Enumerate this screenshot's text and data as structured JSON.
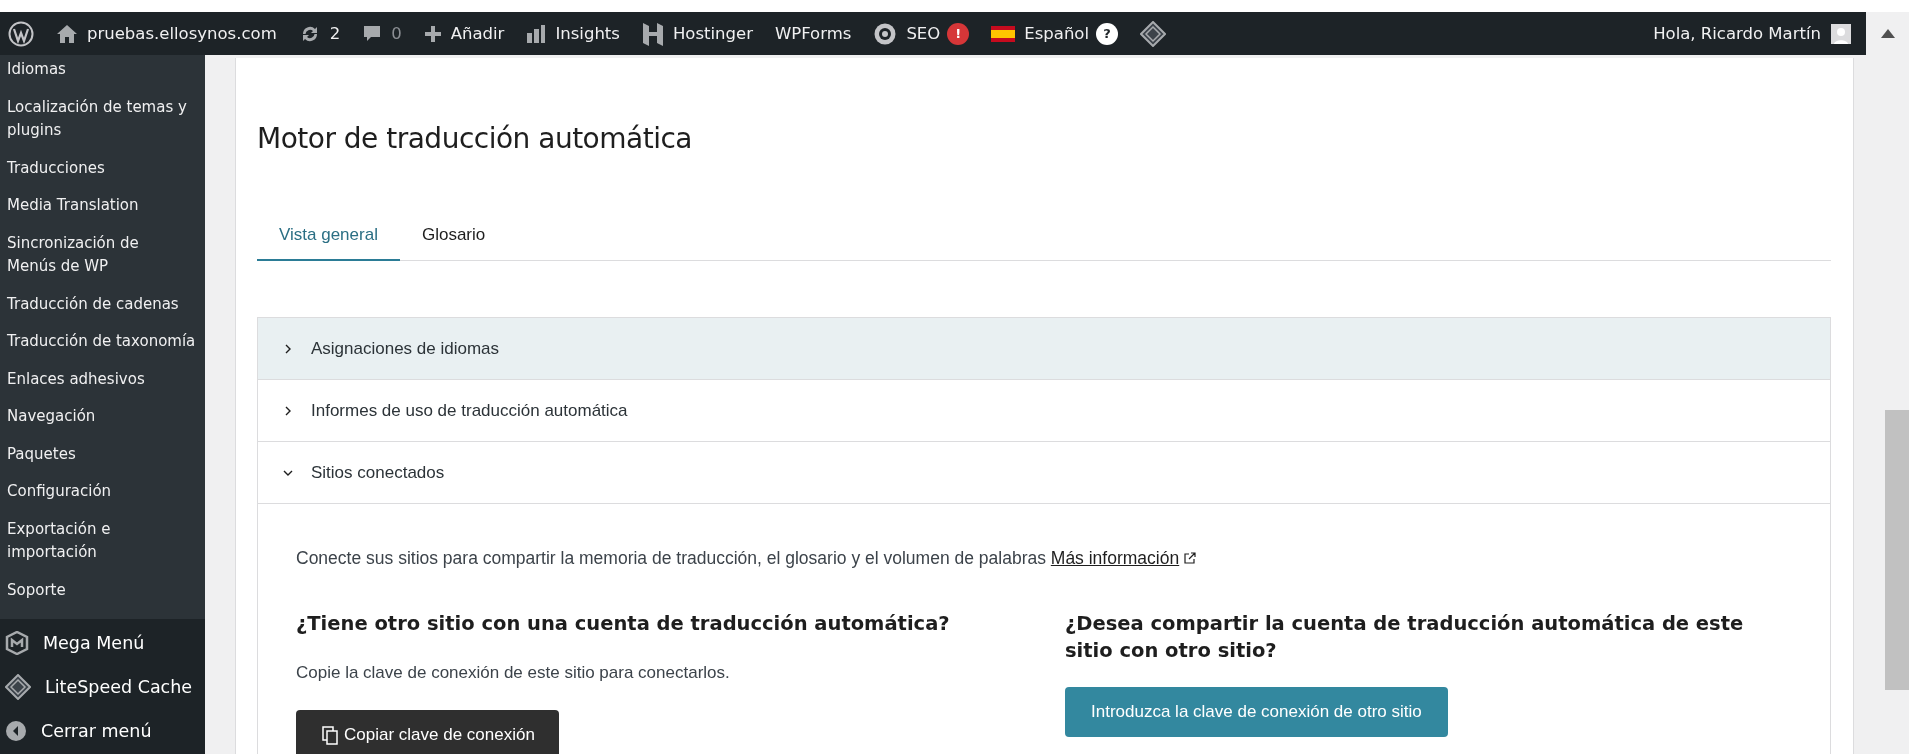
{
  "admin_bar": {
    "items": [
      {
        "kind": "wp-logo"
      },
      {
        "kind": "home",
        "label": "pruebas.ellosynos.com"
      },
      {
        "kind": "updates",
        "label": "2"
      },
      {
        "kind": "comments",
        "label": "0"
      },
      {
        "kind": "add",
        "label": "Añadir"
      },
      {
        "kind": "insights",
        "label": "Insights"
      },
      {
        "kind": "hostinger",
        "label": "Hostinger"
      },
      {
        "kind": "text",
        "label": "WPForms"
      },
      {
        "kind": "seo",
        "label": "SEO",
        "badge": "!"
      },
      {
        "kind": "language",
        "label": "Español",
        "badge": "?"
      },
      {
        "kind": "litespeed"
      }
    ],
    "greeting": "Hola, Ricardo Martín"
  },
  "sidebar": {
    "items": [
      "Idiomas",
      "Localización de temas y plugins",
      "Traducciones",
      "Media Translation",
      "Sincronización de Menús de WP",
      "Traducción de cadenas",
      "Traducción de taxonomía",
      "Enlaces adhesivos",
      "Navegación",
      "Paquetes",
      "Configuración",
      "Exportación e importación",
      "Soporte"
    ],
    "plugins": [
      {
        "kind": "megamenu",
        "label": "Mega Menú"
      },
      {
        "kind": "litespeed",
        "label": "LiteSpeed Cache"
      },
      {
        "kind": "collapse",
        "label": "Cerrar menú"
      }
    ]
  },
  "main": {
    "title": "Motor de traducción automática",
    "tabs": [
      {
        "label": "Vista general",
        "selected": true
      },
      {
        "label": "Glosario",
        "selected": false
      }
    ],
    "sections": [
      {
        "label": "Asignaciones de idiomas",
        "expanded": false,
        "highlighted": true
      },
      {
        "label": "Informes de uso de traducción automática",
        "expanded": false,
        "highlighted": false
      },
      {
        "label": "Sitios conectados",
        "expanded": true,
        "highlighted": false
      }
    ],
    "intro": "Conecte sus sitios para compartir la memoria de traducción, el glosario y el volumen de palabras",
    "intro_link": "Más información",
    "columns": [
      {
        "heading": "¿Tiene otro sitio con una cuenta de traducción automática?",
        "text": "Copie la clave de conexión de este sitio para conectarlos.",
        "button": {
          "kind": "copy",
          "label": "Copiar clave de conexión"
        }
      },
      {
        "heading": "¿Desea compartir la cuenta de traducción automática de este sitio con otro sitio?",
        "button": {
          "kind": "primary",
          "label": "Introduzca la clave de conexión de otro sitio"
        }
      }
    ]
  }
}
